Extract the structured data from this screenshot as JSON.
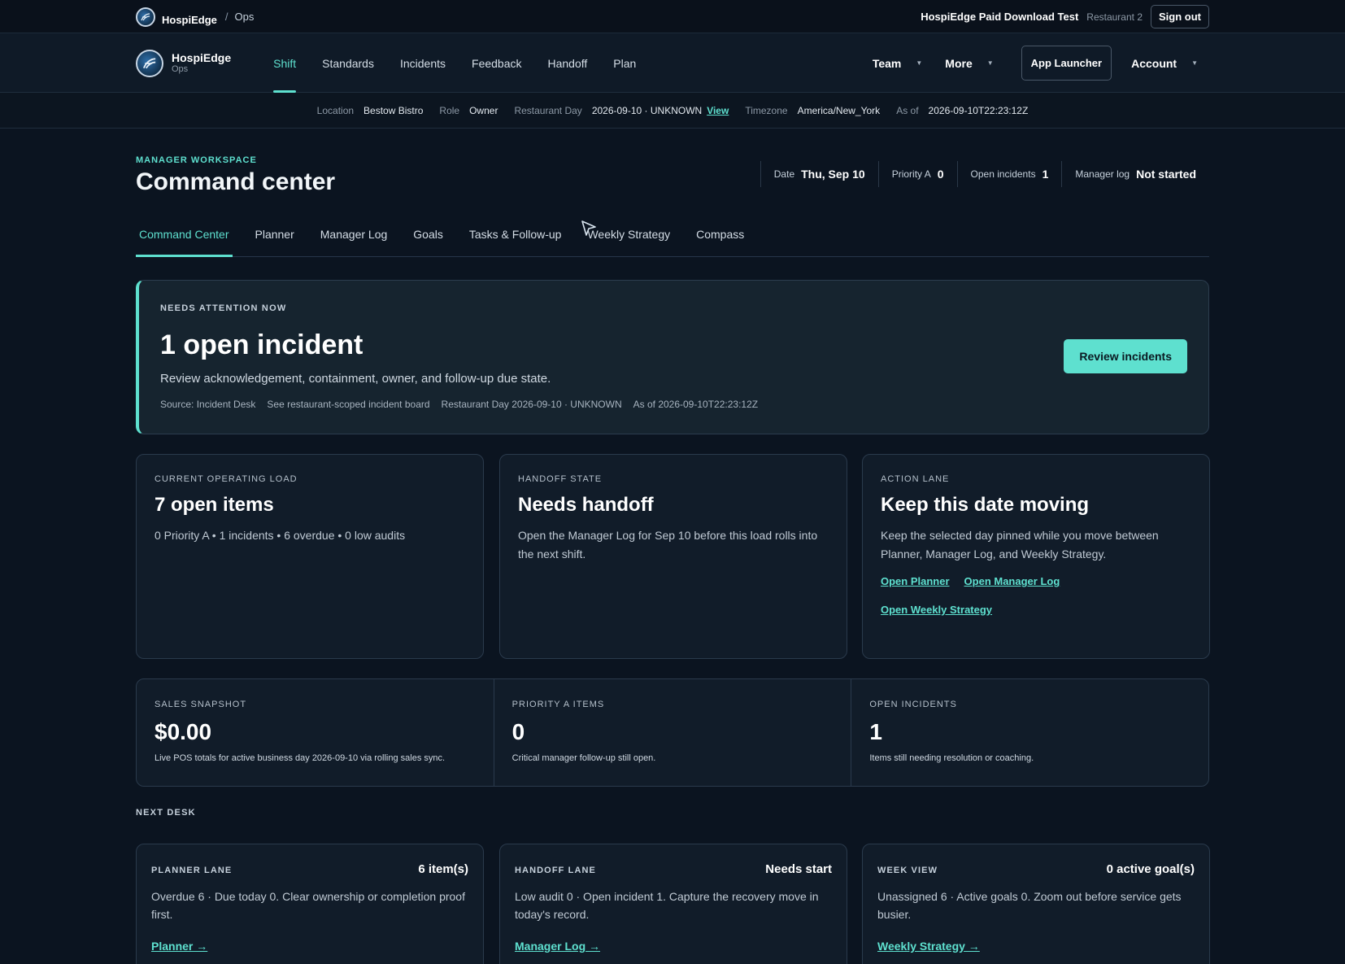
{
  "topbar": {
    "brand": "HospiEdge",
    "crumb": "Ops",
    "org": "HospiEdge Paid Download Test",
    "restaurant": "Restaurant 2",
    "signout": "Sign out"
  },
  "nav": {
    "brand": "HospiEdge",
    "brand_sub": "Ops",
    "links": [
      "Shift",
      "Standards",
      "Incidents",
      "Feedback",
      "Handoff",
      "Plan"
    ],
    "team": "Team",
    "more": "More",
    "launcher": "App Launcher",
    "account": "Account"
  },
  "context": {
    "location_k": "Location",
    "location_v": "Bestow Bistro",
    "role_k": "Role",
    "role_v": "Owner",
    "day_k": "Restaurant Day",
    "day_v": "2026-09-10 · UNKNOWN",
    "day_link": "View",
    "tz_k": "Timezone",
    "tz_v": "America/New_York",
    "asof_k": "As of",
    "asof_v": "2026-09-10T22:23:12Z"
  },
  "header": {
    "eyebrow": "MANAGER WORKSPACE",
    "title": "Command center",
    "stats": [
      {
        "k": "Date",
        "v": "Thu, Sep 10"
      },
      {
        "k": "Priority A",
        "v": "0"
      },
      {
        "k": "Open incidents",
        "v": "1"
      },
      {
        "k": "Manager log",
        "v": "Not started"
      }
    ]
  },
  "subtabs": [
    "Command Center",
    "Planner",
    "Manager Log",
    "Goals",
    "Tasks & Follow-up",
    "Weekly Strategy",
    "Compass"
  ],
  "alert": {
    "eyebrow": "NEEDS ATTENTION NOW",
    "headline": "1 open incident",
    "desc": "Review acknowledgement, containment, owner, and follow-up due state.",
    "meta": [
      "Source: Incident Desk",
      "See restaurant-scoped incident board",
      "Restaurant Day 2026-09-10 · UNKNOWN",
      "As of 2026-09-10T22:23:12Z"
    ],
    "button": "Review incidents"
  },
  "cards": {
    "load": {
      "eyebrow": "CURRENT OPERATING LOAD",
      "title": "7 open items",
      "text": "0 Priority A • 1 incidents • 6 overdue • 0 low audits"
    },
    "handoff": {
      "eyebrow": "HANDOFF STATE",
      "title": "Needs handoff",
      "text": "Open the Manager Log for Sep 10 before this load rolls into the next shift."
    },
    "action": {
      "eyebrow": "ACTION LANE",
      "title": "Keep this date moving",
      "text": "Keep the selected day pinned while you move between Planner, Manager Log, and Weekly Strategy.",
      "links": [
        "Open Planner",
        "Open Manager Log",
        "Open Weekly Strategy"
      ]
    }
  },
  "metrics": [
    {
      "eyebrow": "SALES SNAPSHOT",
      "value": "$0.00",
      "desc": "Live POS totals for active business day 2026-09-10 via rolling sales sync."
    },
    {
      "eyebrow": "PRIORITY A ITEMS",
      "value": "0",
      "desc": "Critical manager follow-up still open."
    },
    {
      "eyebrow": "OPEN INCIDENTS",
      "value": "1",
      "desc": "Items still needing resolution or coaching."
    }
  ],
  "next_desk": {
    "label": "NEXT DESK",
    "lanes": [
      {
        "eyebrow": "PLANNER LANE",
        "badge": "6 item(s)",
        "text": "Overdue 6 · Due today 0. Clear ownership or completion proof first.",
        "link": "Planner →"
      },
      {
        "eyebrow": "HANDOFF LANE",
        "badge": "Needs start",
        "text": "Low audit 0 · Open incident 1. Capture the recovery move in today's record.",
        "link": "Manager Log →"
      },
      {
        "eyebrow": "WEEK VIEW",
        "badge": "0 active goal(s)",
        "text": "Unassigned 6 · Active goals 0. Zoom out before service gets busier.",
        "link": "Weekly Strategy →"
      }
    ]
  },
  "icons": {
    "logo": "hospiedge-logo-icon",
    "chevron": "chevron-down-icon",
    "cursor": "mouse-cursor-icon"
  },
  "colors": {
    "accent": "#5ee0cf",
    "background": "#0b1420",
    "card": "#111c29"
  }
}
